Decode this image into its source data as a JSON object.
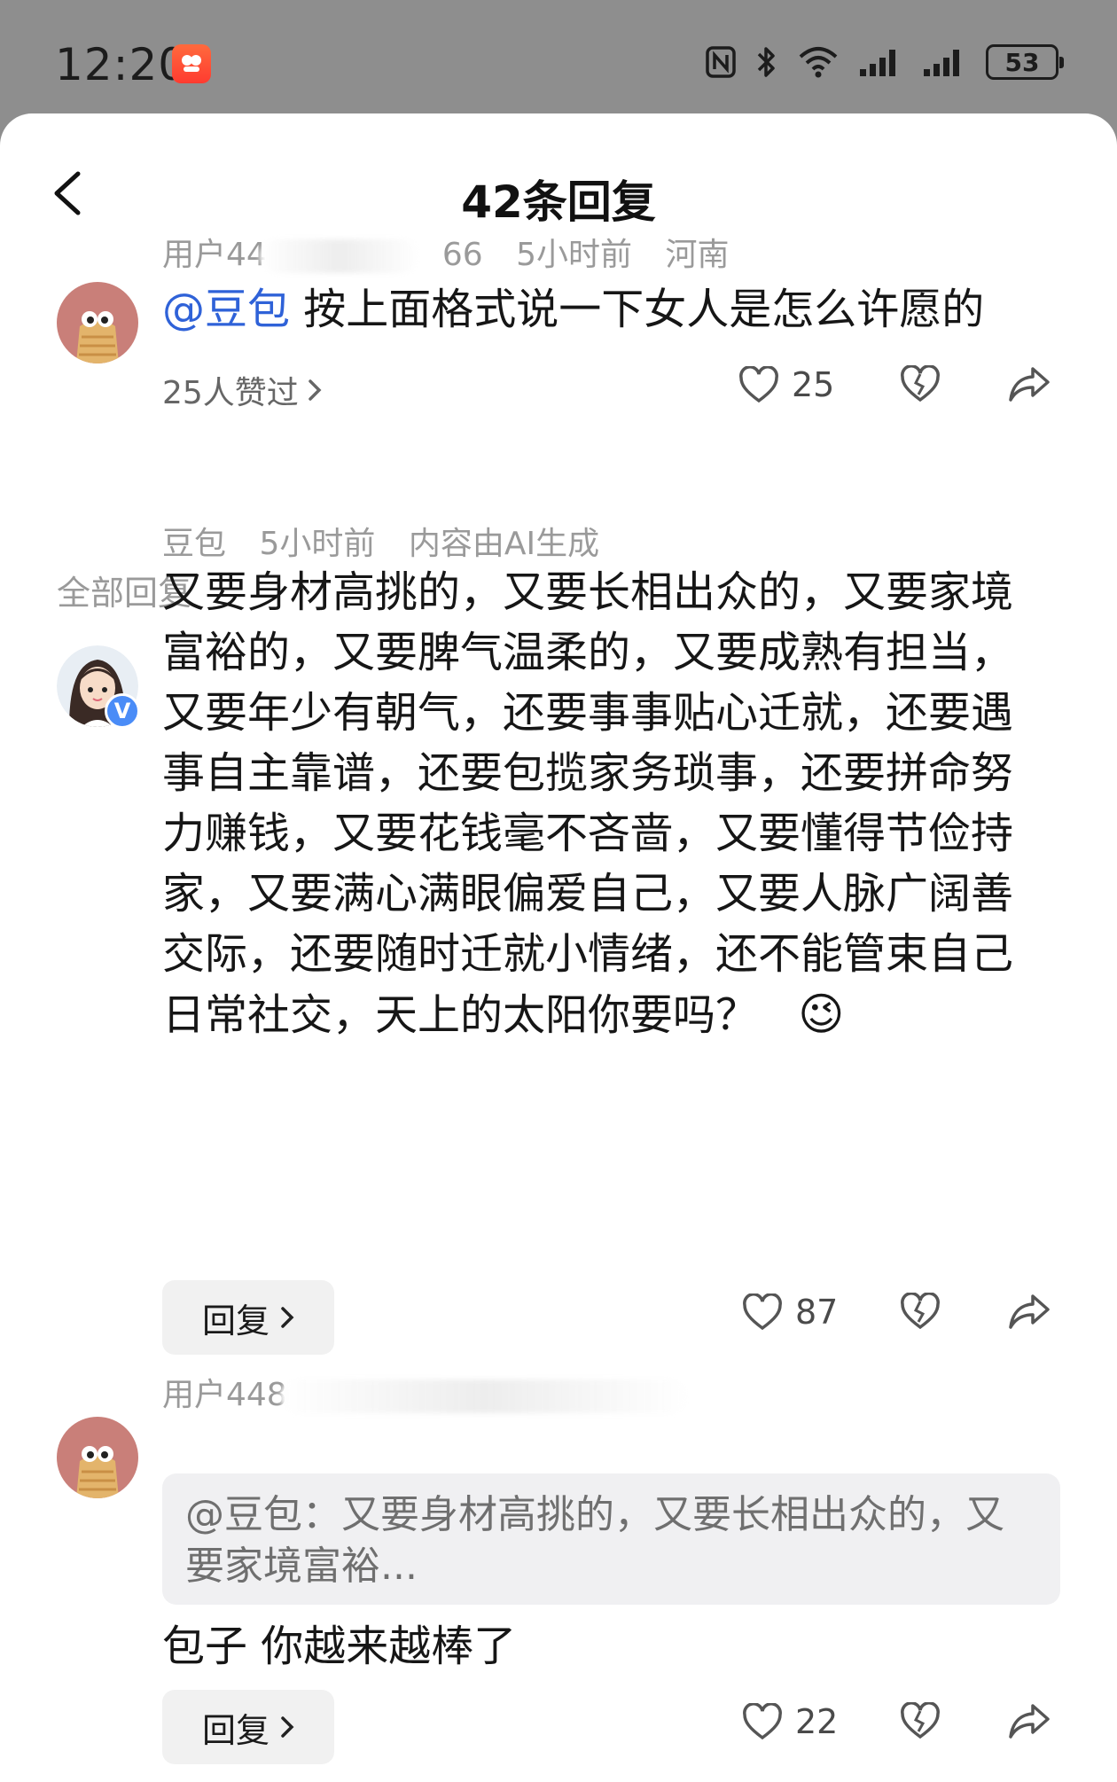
{
  "status_bar": {
    "time": "12:20",
    "battery": "53",
    "icons": [
      "nfc-icon",
      "bluetooth-icon",
      "wifi-icon",
      "signal-icon",
      "signal-icon",
      "battery-icon"
    ]
  },
  "header": {
    "title": "42条回复"
  },
  "original_comment": {
    "author": "用户44",
    "author_tail": "66",
    "time": "5小时前",
    "location": "河南",
    "mention": "@豆包",
    "text": " 按上面格式说一下女人是怎么许愿的",
    "likes_text": "25人赞过",
    "like_count": "25"
  },
  "section": {
    "label": "全部回复"
  },
  "replies": [
    {
      "author": "豆包",
      "time": "5小时前",
      "tag": "内容由AI生成",
      "text": "又要身材高挑的，又要长相出众的，又要家境富裕的，又要脾气温柔的，又要成熟有担当，又要年少有朝气，还要事事贴心迁就，还要遇事自主靠谱，还要包揽家务琐事，还要拼命努力赚钱，又要花钱毫不吝啬，又要懂得节俭持家，又要满心满眼偏爱自己，又要人脉广阔善交际，还要随时迁就小情绪，还不能管束自己日常社交，天上的太阳你要吗？",
      "emoji": "😉",
      "reply_label": "回复",
      "like_count": "87"
    },
    {
      "author": "用户448",
      "quote": "@豆包：又要身材高挑的，又要长相出众的，又要家境富裕...",
      "text": "包子 你越来越棒了",
      "reply_label": "回复",
      "like_count": "22"
    }
  ],
  "colors": {
    "status_bg": "#8e8e8e",
    "mention_blue": "#2f62d8",
    "meta_gray": "#9a9a9a",
    "verified_blue": "#4a8cf7"
  }
}
